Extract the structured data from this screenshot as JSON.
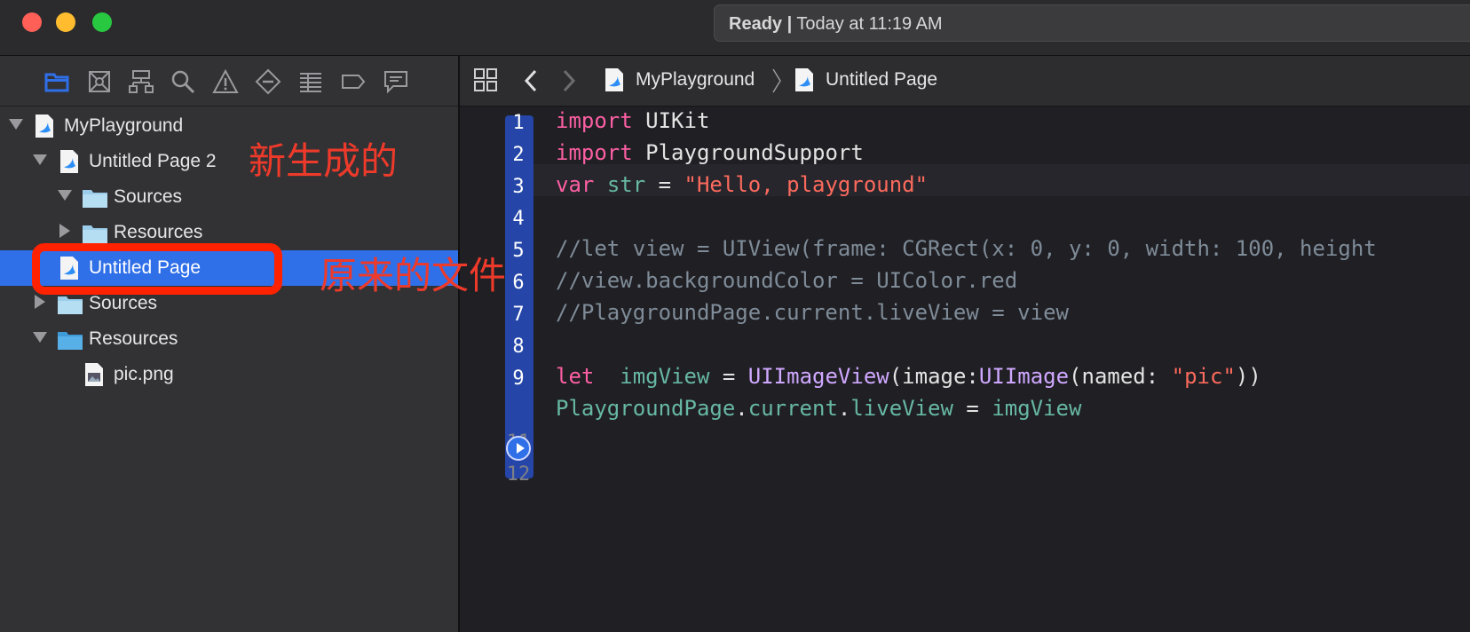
{
  "titlebar": {
    "status_ready": "Ready",
    "status_separator": "|",
    "status_time": "Today at 11:19 AM"
  },
  "navigator": {
    "toolbar_icons": [
      "folder-icon",
      "source-control-icon",
      "symbol-icon",
      "find-icon",
      "issue-icon",
      "test-icon",
      "debug-icon",
      "breakpoint-icon",
      "report-icon"
    ],
    "tree": [
      {
        "label": "MyPlayground",
        "level": 0,
        "expanded": true,
        "kind": "playground"
      },
      {
        "label": "Untitled Page 2",
        "level": 1,
        "expanded": true,
        "kind": "swift"
      },
      {
        "label": "Sources",
        "level": 2,
        "expanded": true,
        "kind": "folder"
      },
      {
        "label": "Resources",
        "level": 2,
        "expanded": false,
        "kind": "folder"
      },
      {
        "label": "Untitled Page",
        "level": 1,
        "selected": true,
        "kind": "swift"
      },
      {
        "label": "Sources",
        "level": 1,
        "expanded": false,
        "kind": "folder"
      },
      {
        "label": "Resources",
        "level": 1,
        "expanded": true,
        "kind": "folder"
      },
      {
        "label": "pic.png",
        "level": 2,
        "kind": "image"
      }
    ]
  },
  "annotations": {
    "new_generated": "新生成的",
    "original_file": "原来的文件"
  },
  "editor": {
    "breadcrumb": [
      "MyPlayground",
      "Untitled Page"
    ],
    "line_numbers": [
      "1",
      "2",
      "3",
      "4",
      "5",
      "6",
      "7",
      "8",
      "9",
      "",
      "11",
      "12"
    ],
    "lines": [
      [
        {
          "t": "import",
          "c": "kw"
        },
        {
          "t": " UIKit",
          "c": "plain"
        }
      ],
      [
        {
          "t": "import",
          "c": "kw"
        },
        {
          "t": " PlaygroundSupport",
          "c": "plain"
        }
      ],
      [
        {
          "t": "var",
          "c": "kw"
        },
        {
          "t": " ",
          "c": "plain"
        },
        {
          "t": "str",
          "c": "tq"
        },
        {
          "t": " = ",
          "c": "plain"
        },
        {
          "t": "\"Hello, playground\"",
          "c": "str"
        }
      ],
      [],
      [
        {
          "t": "//let view = UIView(frame: CGRect(x: 0, y: 0, width: 100, height",
          "c": "cm"
        }
      ],
      [
        {
          "t": "//view.backgroundColor = UIColor.red",
          "c": "cm"
        }
      ],
      [
        {
          "t": "//PlaygroundPage.current.liveView = view",
          "c": "cm"
        }
      ],
      [],
      [
        {
          "t": "let",
          "c": "kw"
        },
        {
          "t": "  ",
          "c": "plain"
        },
        {
          "t": "imgView",
          "c": "tq"
        },
        {
          "t": " = ",
          "c": "plain"
        },
        {
          "t": "UIImageView",
          "c": "type"
        },
        {
          "t": "(image:",
          "c": "plain"
        },
        {
          "t": "UIImage",
          "c": "type"
        },
        {
          "t": "(named: ",
          "c": "plain"
        },
        {
          "t": "\"pic\"",
          "c": "str"
        },
        {
          "t": "))",
          "c": "plain"
        }
      ],
      [
        {
          "t": "PlaygroundPage",
          "c": "tq"
        },
        {
          "t": ".",
          "c": "plain"
        },
        {
          "t": "current",
          "c": "tq"
        },
        {
          "t": ".",
          "c": "plain"
        },
        {
          "t": "liveView",
          "c": "tq"
        },
        {
          "t": " = ",
          "c": "plain"
        },
        {
          "t": "imgView",
          "c": "tq"
        }
      ],
      [],
      []
    ]
  },
  "colors": {
    "selection": "#2f6fe8",
    "annotation_red": "#ee3a2a",
    "keyword": "#fc5fa3",
    "string": "#fc6a5d"
  }
}
